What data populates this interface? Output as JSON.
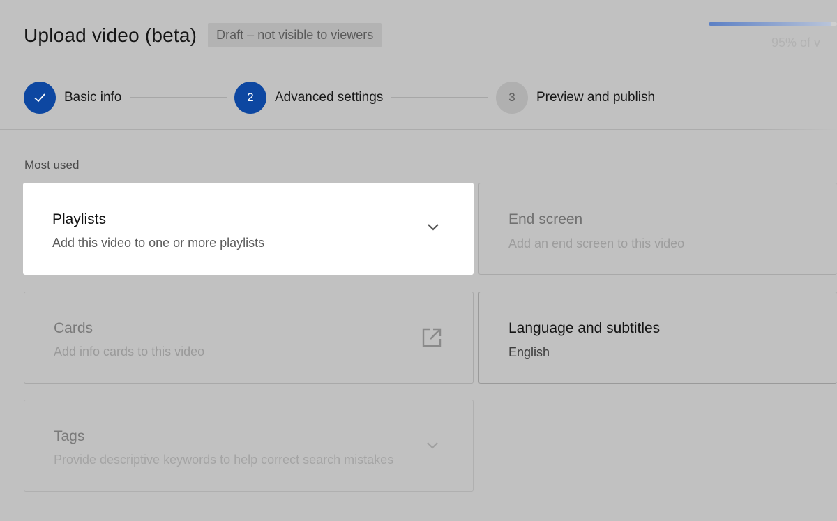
{
  "header": {
    "title": "Upload video (beta)",
    "status_badge": "Draft – not visible to viewers"
  },
  "upload_progress": {
    "percent": 95,
    "text": "95% of v"
  },
  "stepper": {
    "steps": [
      {
        "label": "Basic info",
        "state": "completed",
        "icon": "check-icon"
      },
      {
        "label": "Advanced settings",
        "state": "active",
        "number": "2"
      },
      {
        "label": "Preview and publish",
        "state": "pending",
        "number": "3"
      }
    ]
  },
  "section": {
    "label": "Most used"
  },
  "cards": {
    "playlists": {
      "title": "Playlists",
      "subtitle": "Add this video to one or more playlists",
      "icon": "chevron-down-icon"
    },
    "end_screen": {
      "title": "End screen",
      "subtitle": "Add an end screen to this video"
    },
    "cards": {
      "title": "Cards",
      "subtitle": "Add info cards to this video",
      "icon": "external-link-icon"
    },
    "language": {
      "title": "Language and subtitles",
      "subtitle": "English"
    },
    "tags": {
      "title": "Tags",
      "subtitle": "Provide descriptive keywords to help correct search mistakes",
      "icon": "chevron-down-icon"
    }
  },
  "colors": {
    "accent": "#0d47a1",
    "overlay_background": "#c1c1c1",
    "highlight_card": "#ffffff"
  }
}
